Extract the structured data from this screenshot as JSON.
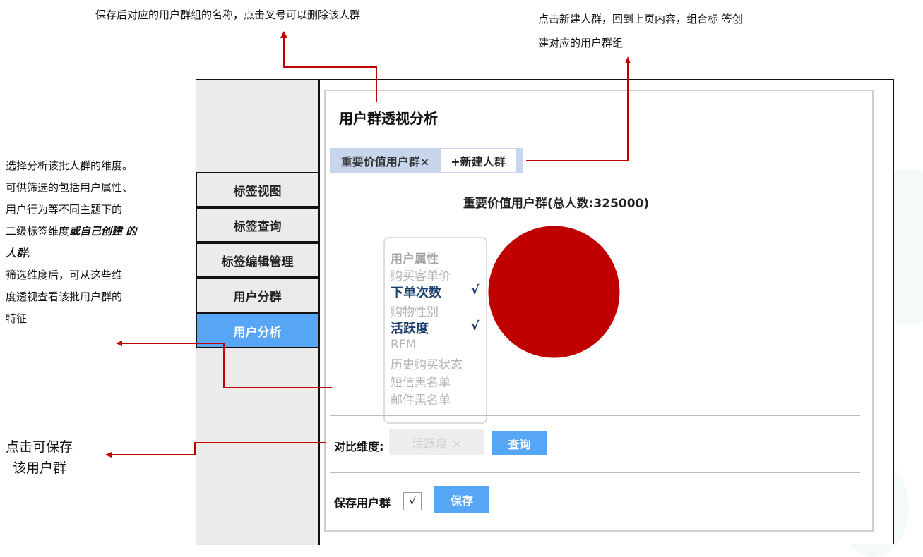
{
  "annotations": {
    "top_left": "保存后对应的用户群组的名称，点击叉号可以删除该人群",
    "top_right_line1": "点击新建人群，回到上页内容，组合标 签创",
    "top_right_line2": "建对应的用户群组",
    "left_lines": [
      "选择分析该批人群的维度。",
      "可供筛选的包括用户属性、",
      "用户行为等不同主题下的",
      "二级标签维度",
      "或自己创建 的",
      "人群",
      ";",
      "筛选维度后，可从这些维",
      "度透视查看该批用户群的",
      "特征"
    ],
    "save_note_line1": "点击可保存",
    "save_note_line2": "该用户群"
  },
  "sidebar": {
    "items": [
      {
        "label": "标签视图"
      },
      {
        "label": "标签查询"
      },
      {
        "label": "标签编辑管理"
      },
      {
        "label": "用户分群"
      },
      {
        "label": "用户分析",
        "active": true
      }
    ]
  },
  "main": {
    "title": "用户群透视分析",
    "group_tag": "重要价值用户群×",
    "new_group": "+新建人群",
    "chart_title": "重要价值用户群(总人数:325000)",
    "dimensions": [
      {
        "label": "用户属性",
        "type": "header"
      },
      {
        "label": "购买客单价"
      },
      {
        "label": "下单次数",
        "selected": true,
        "check": "√"
      },
      {
        "label": "购物性别"
      },
      {
        "label": "活跃度",
        "selected": true,
        "check": "√"
      },
      {
        "label": "RFM"
      },
      {
        "label": "历史购买状态"
      },
      {
        "label": "短信黑名单"
      },
      {
        "label": "邮件黑名单"
      }
    ],
    "compare_label": "对比维度:",
    "compare_value": "活跃度 ×",
    "query_button": "查询",
    "save_label": "保存用户群",
    "save_check": "√",
    "save_button": "保存"
  },
  "chart_data": {
    "type": "pie",
    "title": "重要价值用户群(总人数:325000)",
    "slices": [
      {
        "label": "",
        "value": 325000,
        "color": "#c00000"
      }
    ]
  },
  "colors": {
    "accent_blue": "#57a6f6",
    "annotation_red": "#c00000",
    "tag_bg": "#c7d5ed",
    "pie_red": "#c00000"
  }
}
